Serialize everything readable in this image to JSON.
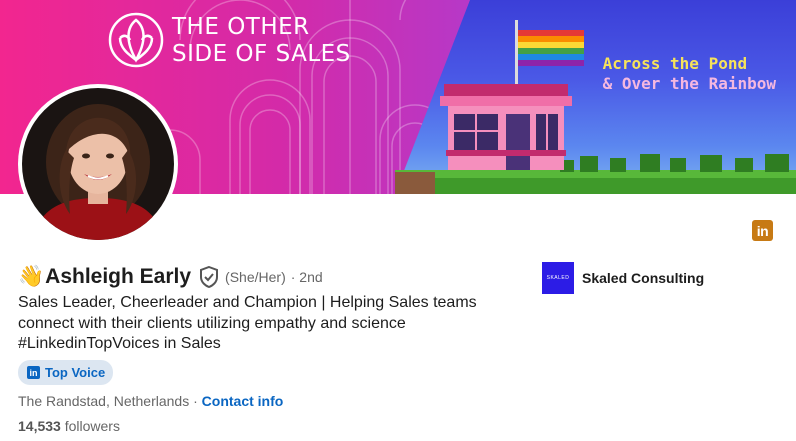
{
  "banner": {
    "brand_line1": "THE OTHER",
    "brand_line2": "SIDE OF SALES",
    "tagline_line1": "Across the Pond",
    "tagline_line2": "& Over the Rainbow"
  },
  "profile": {
    "wave_emoji": "👋",
    "name": "Ashleigh Early",
    "pronouns": "(She/Her)",
    "connection_degree": "· 2nd",
    "headline_lines": [
      "Sales Leader, Cheerleader and Champion | Helping Sales teams",
      "connect with their clients utilizing empathy and science",
      "#LinkedinTopVoices in Sales"
    ],
    "badge": {
      "icon": "in",
      "label": "Top Voice"
    },
    "location": "The Randstad, Netherlands",
    "separator": " · ",
    "contact_label": "Contact info",
    "followers_count": "14,533",
    "followers_label": "followers"
  },
  "company": {
    "logo_text": "SKALED",
    "name": "Skaled Consulting"
  },
  "linkedin_badge": {
    "icon": "in"
  },
  "colors": {
    "banner_pink": "#f2268f",
    "banner_purple": "#a93fd6",
    "link_blue": "#0a66c2",
    "company_blue": "#2c1ce6",
    "linkedin_badge": "#c77a14"
  }
}
